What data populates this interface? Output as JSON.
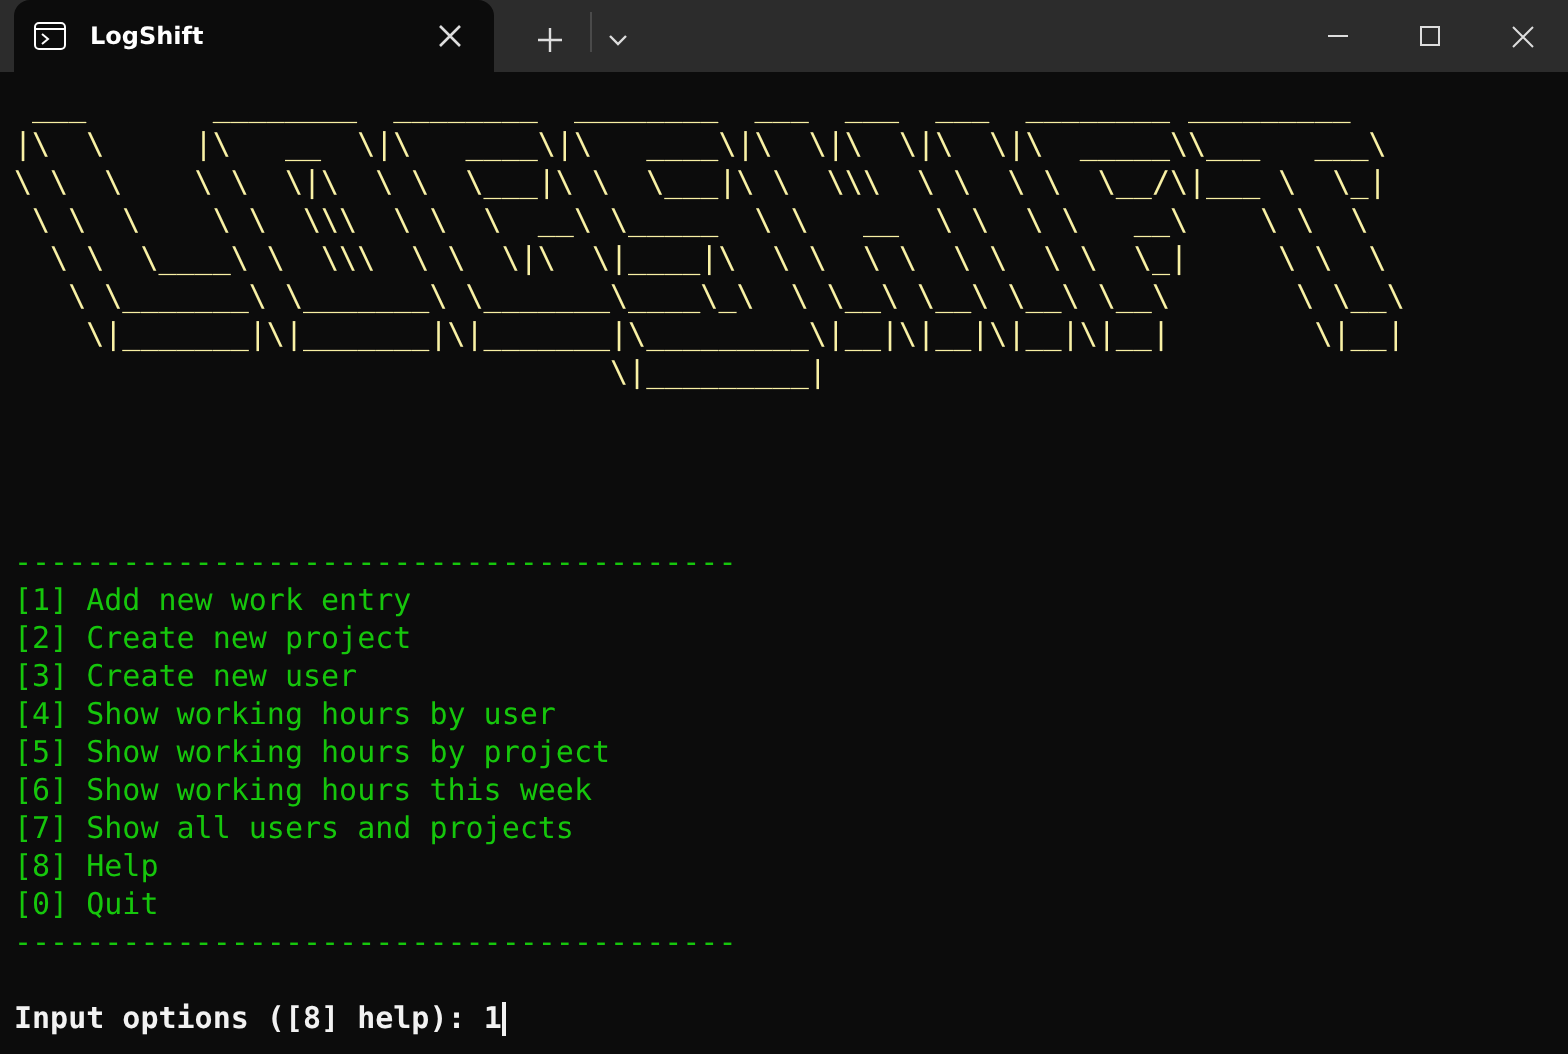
{
  "window": {
    "tabs": [
      {
        "title": "LogShift",
        "selected": true
      }
    ]
  },
  "terminal": {
    "banner": [
      " ___       ________  ________  ________  ___  ___  ___  ________ _________",
      "|\\  \\     |\\   __  \\|\\   ____\\|\\   ____\\|\\  \\|\\  \\|\\  \\|\\  _____\\\\___   ___\\",
      "\\ \\  \\    \\ \\  \\|\\  \\ \\  \\___|\\ \\  \\___|\\ \\  \\\\\\  \\ \\  \\ \\  \\__/\\|___ \\  \\_|",
      " \\ \\  \\    \\ \\  \\\\\\  \\ \\  \\  __\\ \\_____  \\ \\   __  \\ \\  \\ \\   __\\    \\ \\  \\",
      "  \\ \\  \\____\\ \\  \\\\\\  \\ \\  \\|\\  \\|____|\\  \\ \\  \\ \\  \\ \\  \\ \\  \\_|     \\ \\  \\",
      "   \\ \\_______\\ \\_______\\ \\_______\\____\\_\\  \\ \\__\\ \\__\\ \\__\\ \\__\\       \\ \\__\\",
      "    \\|_______|\\|_______|\\|_______|\\_________\\|__|\\|__|\\|__|\\|__|        \\|__|",
      "                                 \\|_________|"
    ],
    "menu": {
      "rule": "----------------------------------------",
      "items": [
        "[1] Add new work entry",
        "[2] Create new project",
        "[3] Create new user",
        "[4] Show working hours by user",
        "[5] Show working hours by project",
        "[6] Show working hours this week",
        "[7] Show all users and projects",
        "[8] Help",
        "[0] Quit"
      ]
    },
    "prompt": {
      "label": "Input options ([8] help): ",
      "value": "1"
    }
  }
}
